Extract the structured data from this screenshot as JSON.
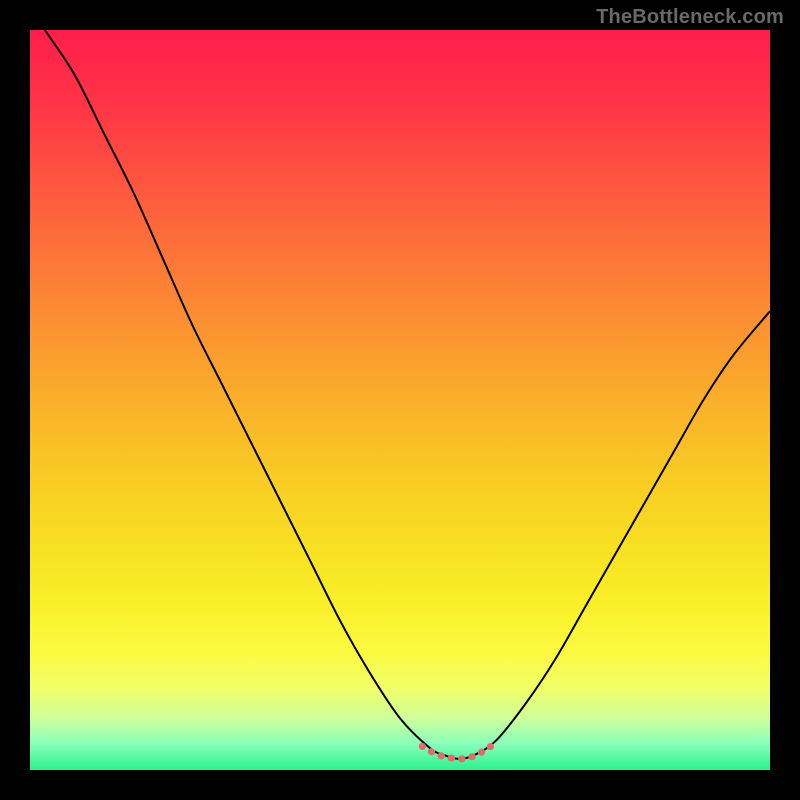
{
  "attribution": "TheBottleneck.com",
  "chart_data": {
    "type": "line",
    "title": "",
    "xlabel": "",
    "ylabel": "",
    "xlim": [
      0,
      100
    ],
    "ylim": [
      0,
      100
    ],
    "series": [
      {
        "name": "bottleneck-curve",
        "color": "#000000",
        "x": [
          2,
          6,
          10,
          14,
          18,
          22,
          26,
          30,
          34,
          38,
          42,
          46,
          50,
          54,
          56,
          58,
          60,
          63,
          67,
          71,
          75,
          79,
          83,
          87,
          91,
          95,
          100
        ],
        "y": [
          100,
          94,
          86,
          78,
          69,
          60,
          52,
          44,
          36,
          28,
          20,
          13,
          7,
          3,
          2,
          1.5,
          2,
          4,
          9,
          15,
          22,
          29,
          36,
          43,
          50,
          56,
          62
        ]
      },
      {
        "name": "flat-region-marker",
        "color": "#DE6E67",
        "x": [
          53,
          54,
          55,
          56,
          57,
          58,
          59,
          60,
          61,
          62,
          63
        ],
        "y": [
          3.2,
          2.6,
          2.1,
          1.8,
          1.6,
          1.5,
          1.6,
          1.9,
          2.4,
          3.0,
          3.8
        ]
      }
    ],
    "background_gradient_stops": [
      {
        "offset": 0.0,
        "color": "#FF1E4B"
      },
      {
        "offset": 0.1,
        "color": "#FF3446"
      },
      {
        "offset": 0.2,
        "color": "#FE5340"
      },
      {
        "offset": 0.3,
        "color": "#FD7339"
      },
      {
        "offset": 0.4,
        "color": "#FB9231"
      },
      {
        "offset": 0.5,
        "color": "#FAAF2A"
      },
      {
        "offset": 0.6,
        "color": "#F9CA24"
      },
      {
        "offset": 0.7,
        "color": "#F8E022"
      },
      {
        "offset": 0.78,
        "color": "#F9F02A"
      },
      {
        "offset": 0.84,
        "color": "#FBFA40"
      },
      {
        "offset": 0.89,
        "color": "#F1FF68"
      },
      {
        "offset": 0.93,
        "color": "#CEFF9C"
      },
      {
        "offset": 0.965,
        "color": "#88FFBA"
      },
      {
        "offset": 1.0,
        "color": "#2CF28E"
      }
    ]
  }
}
